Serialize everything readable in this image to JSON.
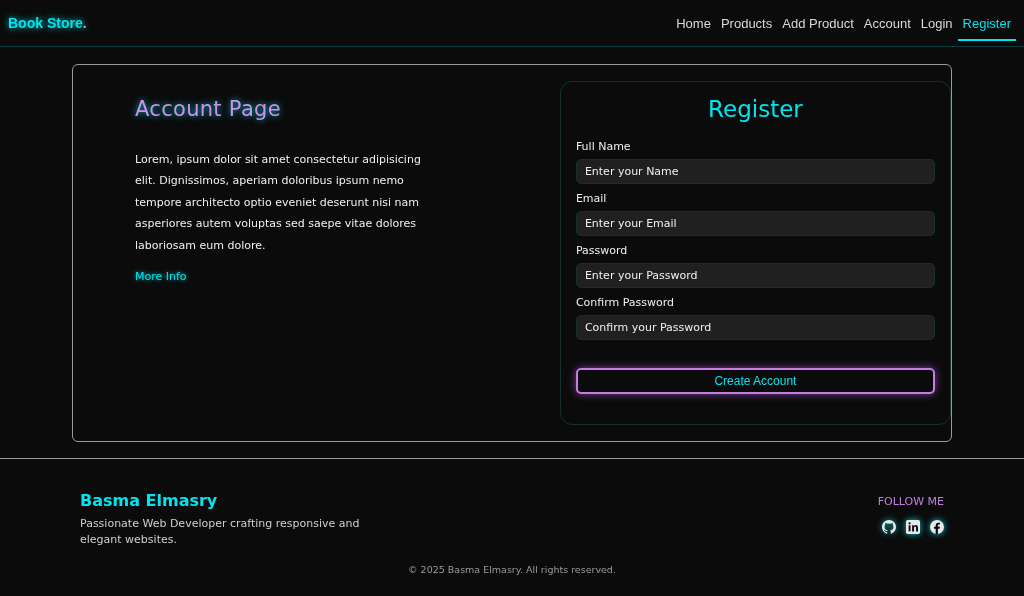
{
  "brand": {
    "name": "Book Store",
    "dot": "."
  },
  "nav": [
    {
      "label": "Home",
      "selected": false
    },
    {
      "label": "Products",
      "selected": false
    },
    {
      "label": "Add Product",
      "selected": false
    },
    {
      "label": "Account",
      "selected": false
    },
    {
      "label": "Login",
      "selected": false
    },
    {
      "label": "Register",
      "selected": true
    }
  ],
  "intro": {
    "title": "Account Page",
    "text": "Lorem, ipsum dolor sit amet consectetur adipisicing elit. Dignissimos, aperiam doloribus ipsum nemo tempore architecto optio eveniet deserunt nisi nam asperiores autem voluptas sed saepe vitae dolores laboriosam eum dolore.",
    "link": "More Info"
  },
  "form": {
    "title": "Register",
    "fields": [
      {
        "label": "Full Name",
        "placeholder": "Enter your Name"
      },
      {
        "label": "Email",
        "placeholder": "Enter your Email"
      },
      {
        "label": "Password",
        "placeholder": "Enter your Password"
      },
      {
        "label": "Confirm Password",
        "placeholder": "Confirm your Password"
      }
    ],
    "button": "Create Account"
  },
  "footer": {
    "name": "Basma Elmasry",
    "tagline": "Passionate Web Developer crafting responsive and elegant websites.",
    "follow": "FOLLOW ME",
    "socials": [
      {
        "kind": "github"
      },
      {
        "kind": "linkedin"
      },
      {
        "kind": "facebook"
      }
    ],
    "copyright": "© 2025 Basma Elmasry. All rights reserved."
  }
}
